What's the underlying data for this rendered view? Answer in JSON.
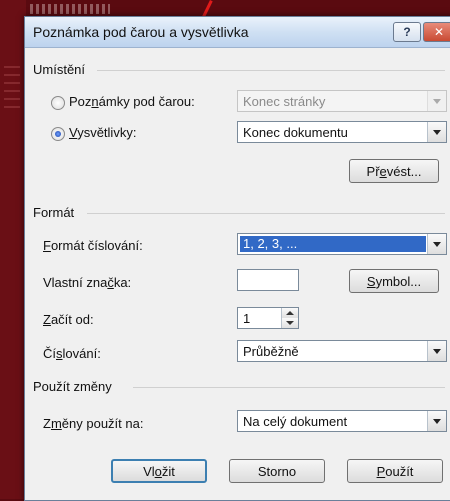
{
  "window": {
    "title": "Poznámka pod čarou a vysvětlivka",
    "help_glyph": "?",
    "close_glyph": "✕"
  },
  "location": {
    "group_label": "Umístění",
    "footnotes": {
      "label_pre": "Poz",
      "label_key": "n",
      "label_post": "ámky pod čarou:",
      "value": "Konec stránky",
      "selected": false
    },
    "endnotes": {
      "label_key": "V",
      "label_post": "ysvětlivky:",
      "value": "Konec dokumentu",
      "selected": true
    },
    "convert_button": {
      "pre": "Př",
      "key": "e",
      "post": "vést..."
    }
  },
  "format": {
    "group_label": "Formát",
    "number_format": {
      "label_key": "F",
      "label_post": "ormát číslování:",
      "value": "1, 2, 3, ..."
    },
    "custom_mark": {
      "label_pre": "Vlastní zna",
      "label_key": "č",
      "label_post": "ka:",
      "value": ""
    },
    "symbol_button": {
      "pre": "",
      "key": "S",
      "post": "ymbol..."
    },
    "start_at": {
      "label_key": "Z",
      "label_post": "ačít od:",
      "value": "1"
    },
    "numbering": {
      "label_pre": "Čí",
      "label_key": "s",
      "label_post": "lování:",
      "value": "Průběžně"
    }
  },
  "apply": {
    "group_label": "Použít změny",
    "apply_to": {
      "label_pre": "Z",
      "label_key": "m",
      "label_post": "ěny použít na:",
      "value": "Na celý dokument"
    }
  },
  "buttons": {
    "insert": {
      "pre": "Vl",
      "key": "o",
      "post": "žit"
    },
    "cancel": {
      "label": "Storno"
    },
    "apply": {
      "pre": "",
      "key": "P",
      "post": "oužít"
    }
  }
}
